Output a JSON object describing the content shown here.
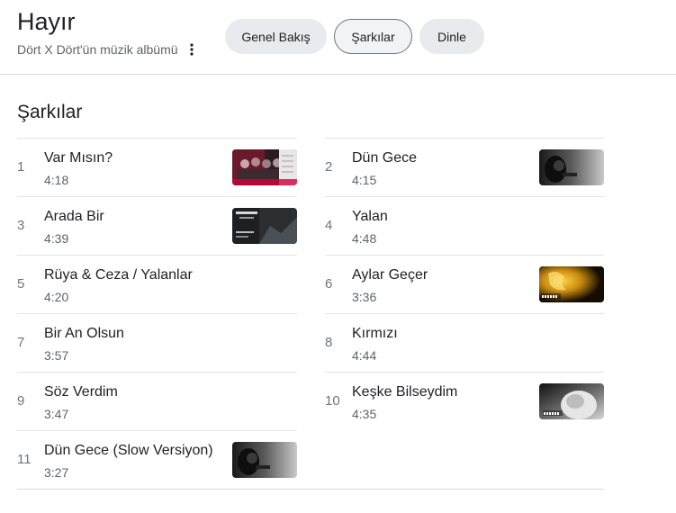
{
  "header": {
    "title": "Hayır",
    "subtitle": "Dört X Dört'ün müzik albümü",
    "tabs": [
      "Genel Bakış",
      "Şarkılar",
      "Dinle"
    ],
    "active_tab": "Şarkılar"
  },
  "section": {
    "title": "Şarkılar"
  },
  "songs": [
    {
      "number": "1",
      "title": "Var Mısın?",
      "duration": "4:18",
      "thumbnail": "video-thumbnail"
    },
    {
      "number": "2",
      "title": "Dün Gece",
      "duration": "4:15",
      "thumbnail": "video-thumbnail"
    },
    {
      "number": "3",
      "title": "Arada Bir",
      "duration": "4:39",
      "thumbnail": "video-thumbnail"
    },
    {
      "number": "4",
      "title": "Yalan",
      "duration": "4:48"
    },
    {
      "number": "5",
      "title": "Rüya & Ceza / Yalanlar",
      "duration": "4:20"
    },
    {
      "number": "6",
      "title": "Aylar Geçer",
      "duration": "3:36",
      "thumbnail": "video-thumbnail"
    },
    {
      "number": "7",
      "title": "Bir An Olsun",
      "duration": "3:57"
    },
    {
      "number": "8",
      "title": "Kırmızı",
      "duration": "4:44"
    },
    {
      "number": "9",
      "title": "Söz Verdim",
      "duration": "3:47"
    },
    {
      "number": "10",
      "title": "Keşke Bilseydim",
      "duration": "4:35",
      "thumbnail": "video-thumbnail"
    },
    {
      "number": "11",
      "title": "Dün Gece (Slow Versiyon)",
      "duration": "3:27",
      "thumbnail": "video-thumbnail"
    }
  ]
}
